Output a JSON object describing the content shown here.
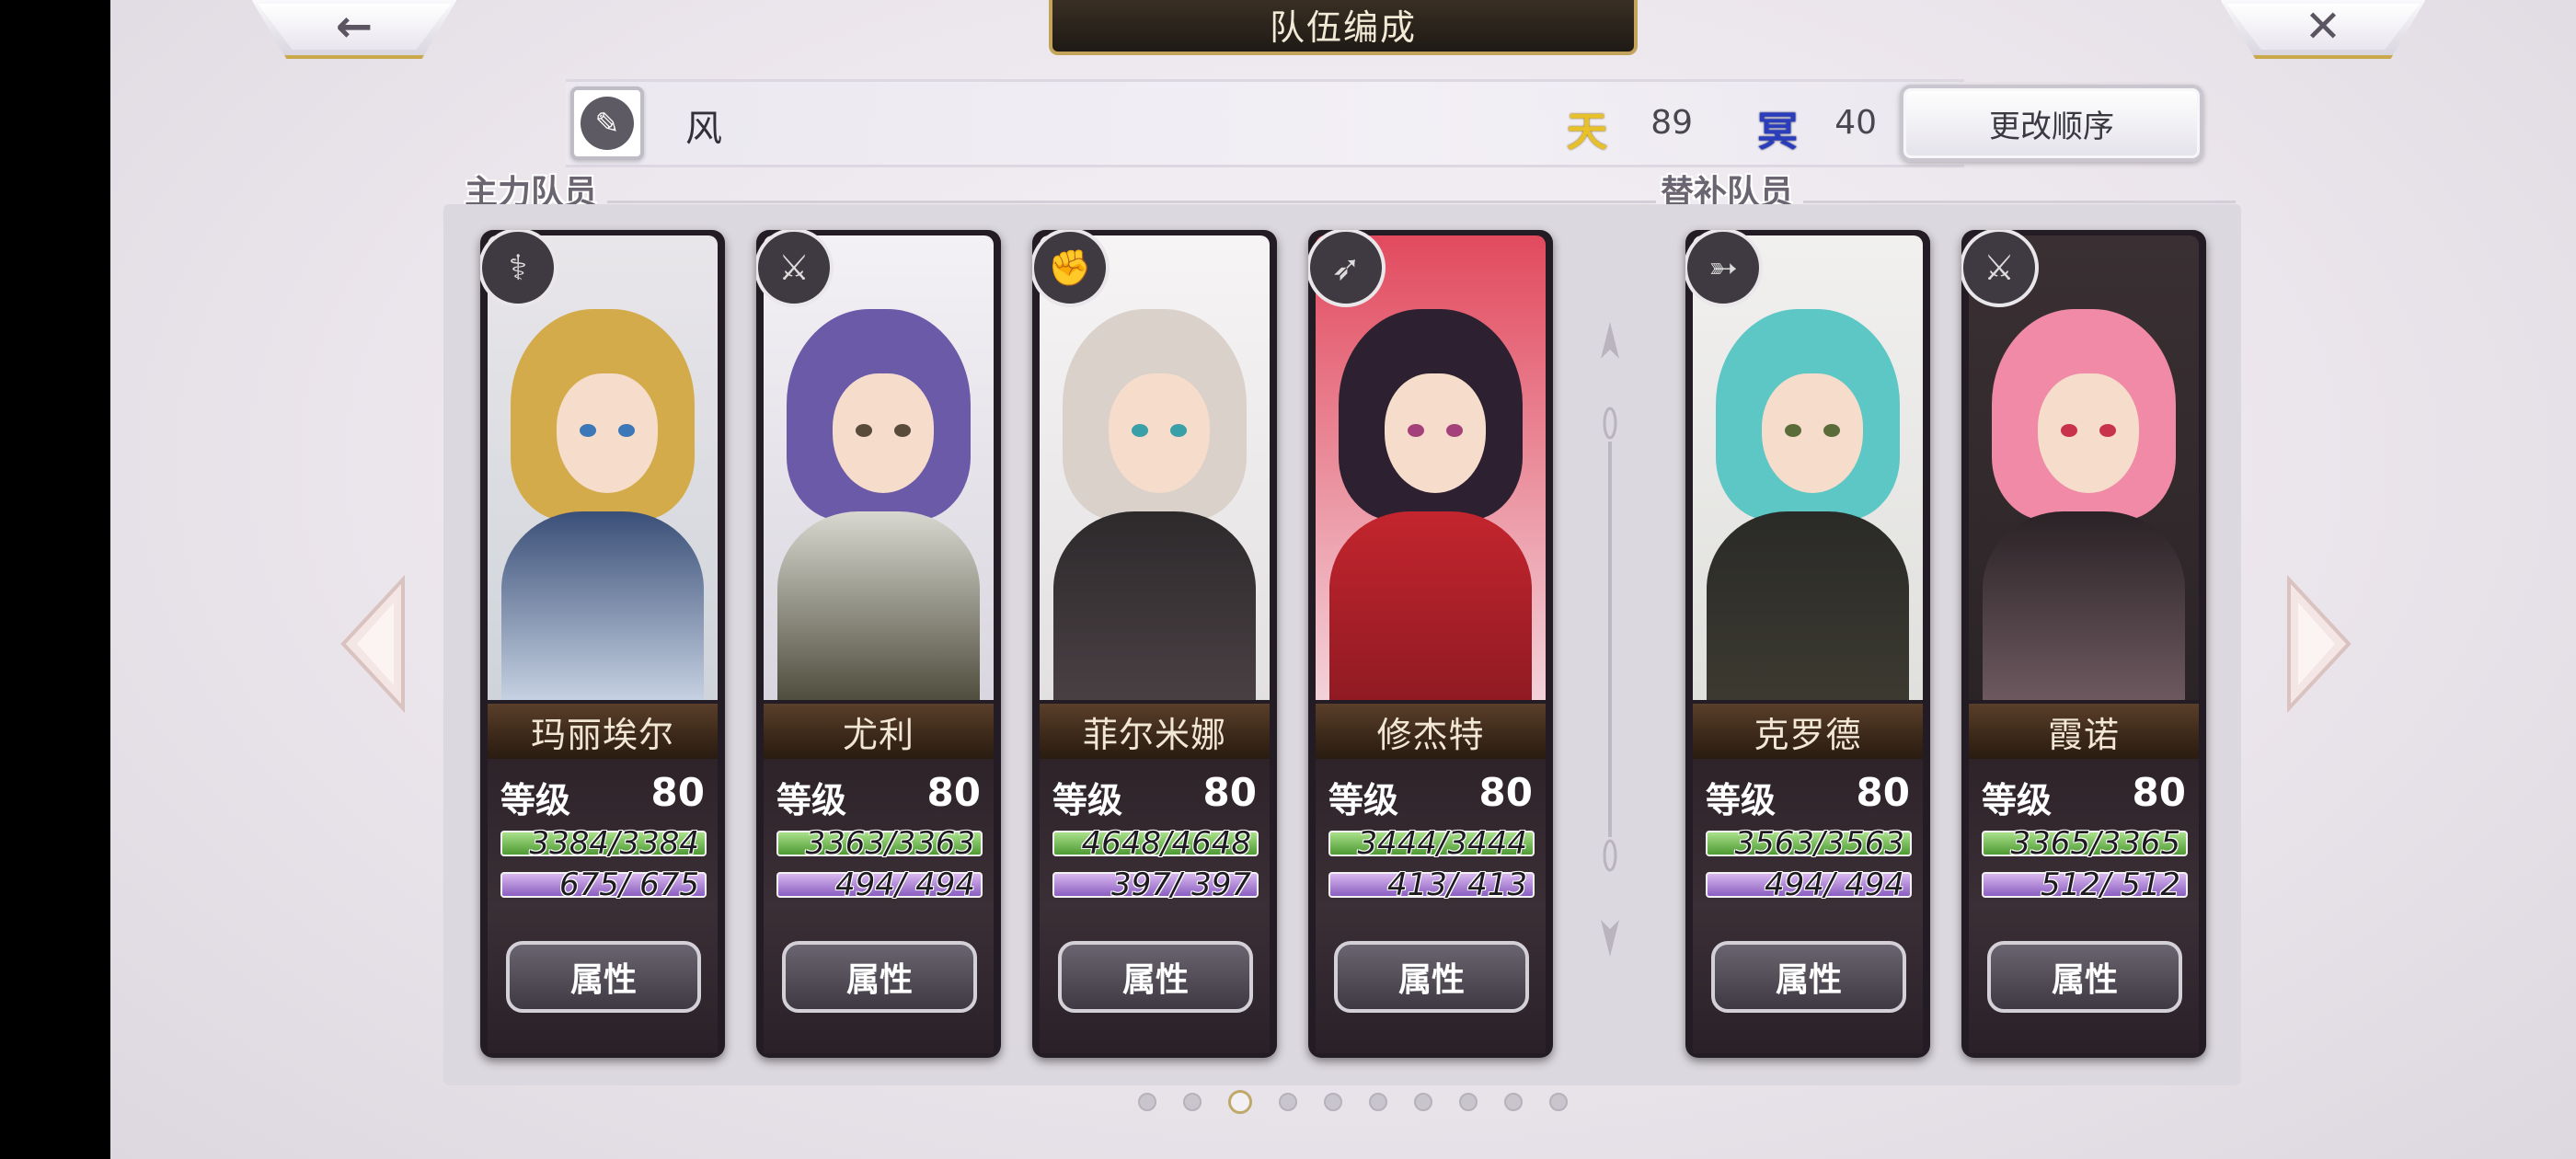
{
  "header": {
    "title": "队伍编成",
    "back_icon": "arrow-left-icon",
    "close_icon": "close-icon"
  },
  "info_bar": {
    "team_name": "风",
    "sky_label": "天",
    "sky_value": "89",
    "under_label": "冥",
    "under_value": "40",
    "reorder_label": "更改顺序"
  },
  "sections": {
    "main_label": "主力队员",
    "sub_label": "替补队员"
  },
  "main_members": [
    {
      "name": "玛丽埃尔",
      "level_label": "等级",
      "level": "80",
      "hp": "3384/3384",
      "mp": "675/ 675",
      "attr_label": "属性",
      "class_icon": "staff-icon"
    },
    {
      "name": "尤利",
      "level_label": "等级",
      "level": "80",
      "hp": "3363/3363",
      "mp": "494/ 494",
      "attr_label": "属性",
      "class_icon": "katana-icon"
    },
    {
      "name": "菲尔米娜",
      "level_label": "等级",
      "level": "80",
      "hp": "4648/4648",
      "mp": "397/ 397",
      "attr_label": "属性",
      "class_icon": "fist-icon"
    },
    {
      "name": "修杰特",
      "level_label": "等级",
      "level": "80",
      "hp": "3444/3444",
      "mp": "413/ 413",
      "attr_label": "属性",
      "class_icon": "spear-icon"
    }
  ],
  "sub_members": [
    {
      "name": "克罗德",
      "level_label": "等级",
      "level": "80",
      "hp": "3563/3563",
      "mp": "494/ 494",
      "attr_label": "属性",
      "class_icon": "bow-icon"
    },
    {
      "name": "霞诺",
      "level_label": "等级",
      "level": "80",
      "hp": "3365/3365",
      "mp": "512/ 512",
      "attr_label": "属性",
      "class_icon": "sword-icon"
    }
  ],
  "pagination": {
    "total": 10,
    "active_index": 2
  },
  "colors": {
    "hp": "#6fc24a",
    "mp": "#a77ad6",
    "gold": "#c9a94a",
    "sky": "#e8c02a",
    "under": "#2a3dbd"
  }
}
